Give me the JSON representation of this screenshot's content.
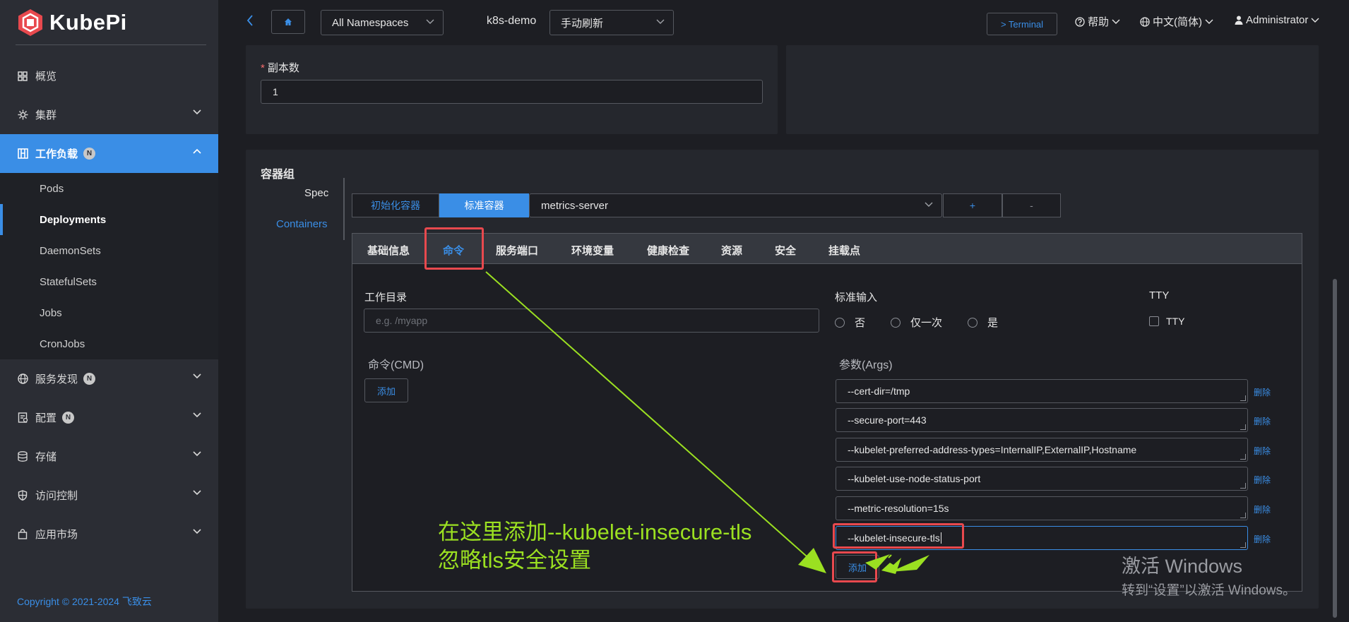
{
  "sidebar": {
    "logo_text": "KubePi",
    "items": [
      {
        "label": "概览",
        "icon": "dashboard-icon"
      },
      {
        "label": "集群",
        "icon": "cluster-icon"
      },
      {
        "label": "工作负载",
        "icon": "workload-icon",
        "badge": "N"
      },
      {
        "label": "服务发现",
        "icon": "globe-icon",
        "badge": "N"
      },
      {
        "label": "配置",
        "icon": "config-icon",
        "badge": "N"
      },
      {
        "label": "存储",
        "icon": "database-icon"
      },
      {
        "label": "访问控制",
        "icon": "shield-icon"
      },
      {
        "label": "应用市场",
        "icon": "bag-icon"
      }
    ],
    "sub_items": [
      "Pods",
      "Deployments",
      "DaemonSets",
      "StatefulSets",
      "Jobs",
      "CronJobs"
    ],
    "copyright": "Copyright © 2021-2024 飞致云"
  },
  "topbar": {
    "namespace": "All Namespaces",
    "cluster": "k8s-demo",
    "refresh": "手动刷新",
    "terminal": "> Terminal",
    "help": "帮助",
    "language": "中文(简体)",
    "user": "Administrator"
  },
  "replicas": {
    "label": "副本数",
    "required_mark": "*",
    "value": "1"
  },
  "containers": {
    "title": "容器组",
    "spec_tab": "Spec",
    "containers_tab": "Containers",
    "init_btn": "初始化容器",
    "std_btn": "标准容器",
    "selected_container": "metrics-server",
    "add_btn": "+",
    "remove_btn": "-"
  },
  "tabs": [
    "基础信息",
    "命令",
    "服务端口",
    "环境变量",
    "健康检查",
    "资源",
    "安全",
    "挂载点"
  ],
  "command": {
    "workdir_label": "工作目录",
    "workdir_placeholder": "e.g. /myapp",
    "stdin_label": "标准输入",
    "stdin_options": [
      "否",
      "仅一次",
      "是"
    ],
    "tty_label": "TTY",
    "tty_check": "TTY",
    "cmd_label": "命令(CMD)",
    "cmd_add": "添加",
    "args_label": "参数(Args)",
    "args": [
      "--cert-dir=/tmp",
      "--secure-port=443",
      "--kubelet-preferred-address-types=InternalIP,ExternalIP,Hostname",
      "--kubelet-use-node-status-port",
      "--metric-resolution=15s",
      "--kubelet-insecure-tls"
    ],
    "arg_delete": "删除",
    "args_add": "添加"
  },
  "annotation": {
    "line1": "在这里添加--kubelet-insecure-tls",
    "line2": "忽略tls安全设置"
  },
  "watermark": {
    "line1": "激活 Windows",
    "line2": "转到“设置”以激活 Windows。"
  },
  "colors": {
    "accent": "#3a8ee6",
    "annotation": "#9be021",
    "highlight": "#e8494e"
  }
}
